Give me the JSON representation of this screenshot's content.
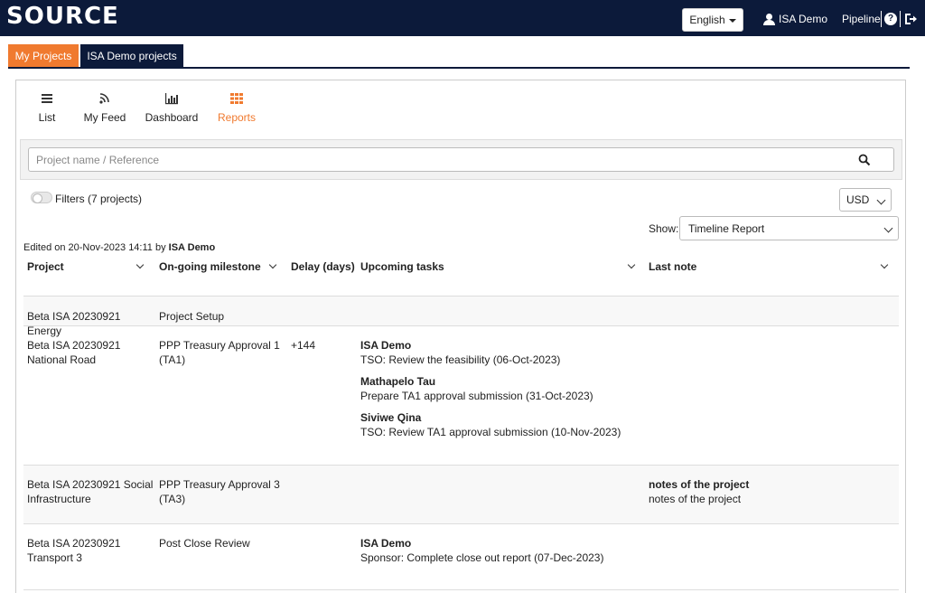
{
  "header": {
    "logo": "SOURCE",
    "language": "English",
    "user": "ISA Demo",
    "pipeline": "Pipeline"
  },
  "tabs": [
    {
      "label": "My Projects",
      "active": true
    },
    {
      "label": "ISA Demo projects",
      "active": false
    }
  ],
  "views": [
    {
      "label": "List",
      "icon": "list-icon"
    },
    {
      "label": "My Feed",
      "icon": "rss-icon"
    },
    {
      "label": "Dashboard",
      "icon": "bar-chart-icon"
    },
    {
      "label": "Reports",
      "icon": "grid-icon",
      "active": true
    }
  ],
  "search": {
    "placeholder": "Project name / Reference",
    "value": ""
  },
  "filters": {
    "label": "Filters (7 projects)",
    "enabled": false
  },
  "currency": "USD",
  "show": {
    "label": "Show:",
    "value": "Timeline Report"
  },
  "edited": {
    "prefix": "Edited on 20-Nov-2023 14:11 by",
    "user": "ISA Demo"
  },
  "table": {
    "headers": {
      "project": "Project",
      "milestone": "On-going milestone",
      "delay": "Delay (days)",
      "tasks": "Upcoming tasks",
      "note": "Last note"
    },
    "rows": [
      {
        "project": "Beta ISA 20230921 Energy",
        "milestone": "Project Setup",
        "delay": "",
        "tasks": [],
        "note_title": "",
        "note_body": ""
      },
      {
        "project": "Beta ISA 20230921 National Road",
        "milestone": "PPP Treasury Approval 1 (TA1)",
        "delay": "+144",
        "tasks": [
          {
            "assignee": "ISA Demo",
            "task": "TSO: Review the feasibility (06-Oct-2023)"
          },
          {
            "assignee": "Mathapelo Tau",
            "task": "Prepare TA1 approval submission (31-Oct-2023)"
          },
          {
            "assignee": "Siviwe Qina",
            "task": "TSO: Review TA1 approval submission (10-Nov-2023)"
          }
        ],
        "note_title": "",
        "note_body": ""
      },
      {
        "project": "Beta ISA 20230921 Social Infrastructure",
        "milestone": "PPP Treasury Approval 3 (TA3)",
        "delay": "",
        "tasks": [],
        "note_title": "notes of the project",
        "note_body": "notes of the project"
      },
      {
        "project": "Beta ISA 20230921 Transport 3",
        "milestone": "Post Close Review",
        "delay": "",
        "tasks": [
          {
            "assignee": "ISA Demo",
            "task": "Sponsor: Complete close out report (07-Dec-2023)"
          }
        ],
        "note_title": "",
        "note_body": ""
      }
    ]
  },
  "colors": {
    "navbar": "#0c1a3a",
    "accent": "#f07a2f"
  }
}
